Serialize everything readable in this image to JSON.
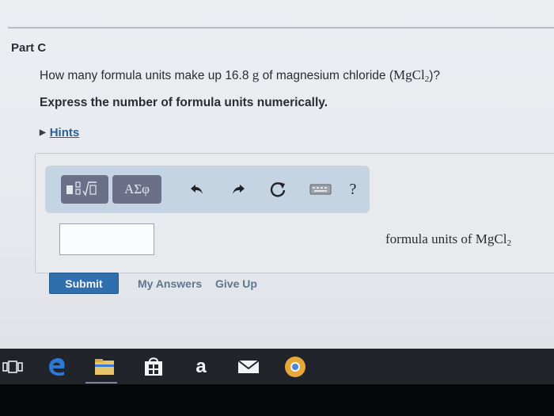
{
  "part": {
    "title": "Part C"
  },
  "question": {
    "prefix": "How many formula units make up 16.8",
    "unit": "g",
    "middle": "of magnesium chloride (",
    "formula_main": "MgCl",
    "formula_sub": "2",
    "suffix": ")?"
  },
  "instruction": "Express the number of formula units numerically.",
  "hints": {
    "label": "Hints"
  },
  "toolbar": {
    "greek_label": "ΑΣφ",
    "help_label": "?"
  },
  "answer": {
    "value": "",
    "units_prefix": "formula units of MgCl",
    "units_sub": "2"
  },
  "actions": {
    "submit_label": "Submit",
    "my_answers_label": "My Answers",
    "give_up_label": "Give Up"
  },
  "taskbar": {
    "amazon_glyph": "a"
  },
  "colors": {
    "accent": "#2f6fae",
    "toolbar_bg": "#c5d4e2",
    "tool_button": "#6b6f88",
    "link": "#2a5f8f",
    "taskbar": "#22242b"
  },
  "icons": [
    "templates-icon",
    "undo-icon",
    "redo-icon",
    "reset-icon",
    "keyboard-icon",
    "help-icon",
    "task-view-icon",
    "edge-icon",
    "file-explorer-icon",
    "store-icon",
    "amazon-icon",
    "mail-icon",
    "chrome-icon"
  ]
}
